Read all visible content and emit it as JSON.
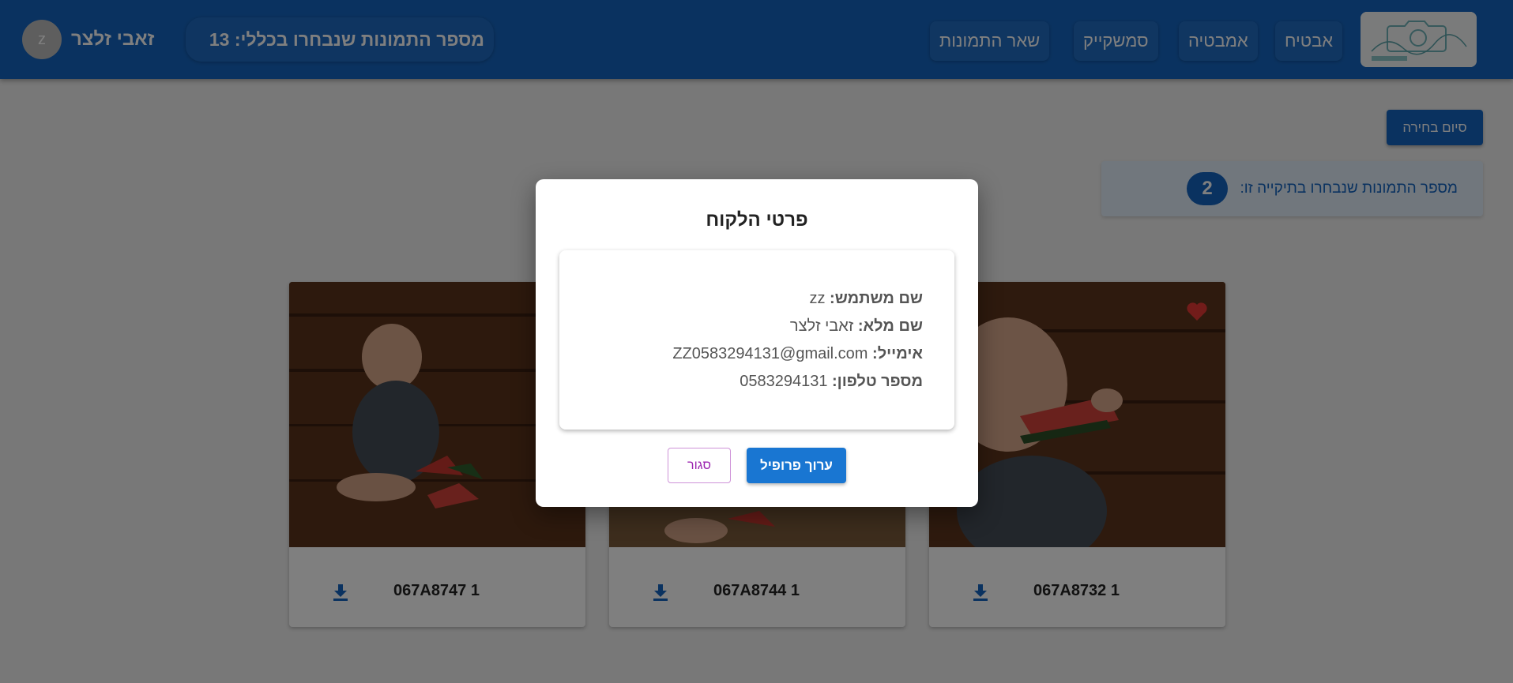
{
  "header": {
    "nav": [
      {
        "label": "אבטיח"
      },
      {
        "label": "אמבטיה"
      },
      {
        "label": "סמשקייק"
      },
      {
        "label": "שאר  התמונות"
      }
    ],
    "total_selected_label": "מספר התמונות שנבחרו בכללי:",
    "total_selected_count": "13",
    "user_name": "זאבי זלצר",
    "avatar_letter": "z"
  },
  "main": {
    "finish_button": "סיום בחירה",
    "folder_selected_label": "מספר התמונות שנבחרו בתיקייה זו:",
    "folder_selected_count": "2",
    "photos": [
      {
        "caption": "067A8747 1",
        "liked": false
      },
      {
        "caption": "067A8744 1",
        "liked": false
      },
      {
        "caption": "067A8732 1",
        "liked": true
      }
    ]
  },
  "dialog": {
    "title": "פרטי הלקוח",
    "fields": [
      {
        "label": "שם משתמש:",
        "value": "zz"
      },
      {
        "label": "שם מלא:",
        "value": "זאבי זלצר"
      },
      {
        "label": "אימייל:",
        "value": "ZZ0583294131@gmail.com"
      },
      {
        "label": "מספר טלפון:",
        "value": "0583294131"
      }
    ],
    "edit_button": "ערוך פרופיל",
    "close_button": "סגור"
  },
  "colors": {
    "primary": "#1565c0",
    "heart": "#e53935",
    "close_button": "#9c27b0"
  }
}
